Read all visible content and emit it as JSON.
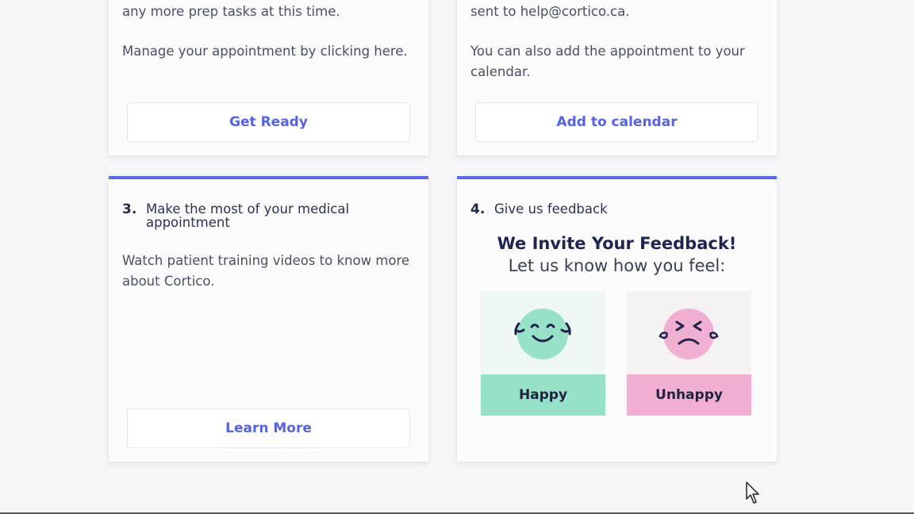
{
  "card1": {
    "text_top": "any more prep tasks at this time.",
    "text_manage": "Manage your appointment by clicking here.",
    "button_label": "Get Ready"
  },
  "card2": {
    "text_top": "sent to help@cortico.ca.",
    "text_calendar": "You can also add the appointment to your calendar.",
    "button_label": "Add to calendar"
  },
  "card3": {
    "number": "3.",
    "title": "Make the most of your medical appointment",
    "text": "Watch patient training videos to know more about Cortico.",
    "button_label": "Learn More"
  },
  "card4": {
    "number": "4.",
    "title": "Give us feedback",
    "feedback_title": "We Invite Your Feedback!",
    "feedback_subtitle": "Let us know how you feel:",
    "happy_label": "Happy",
    "unhappy_label": "Unhappy"
  },
  "colors": {
    "accent": "#5b6ae8",
    "happy": "#97e1c8",
    "unhappy": "#f1b0d2"
  }
}
